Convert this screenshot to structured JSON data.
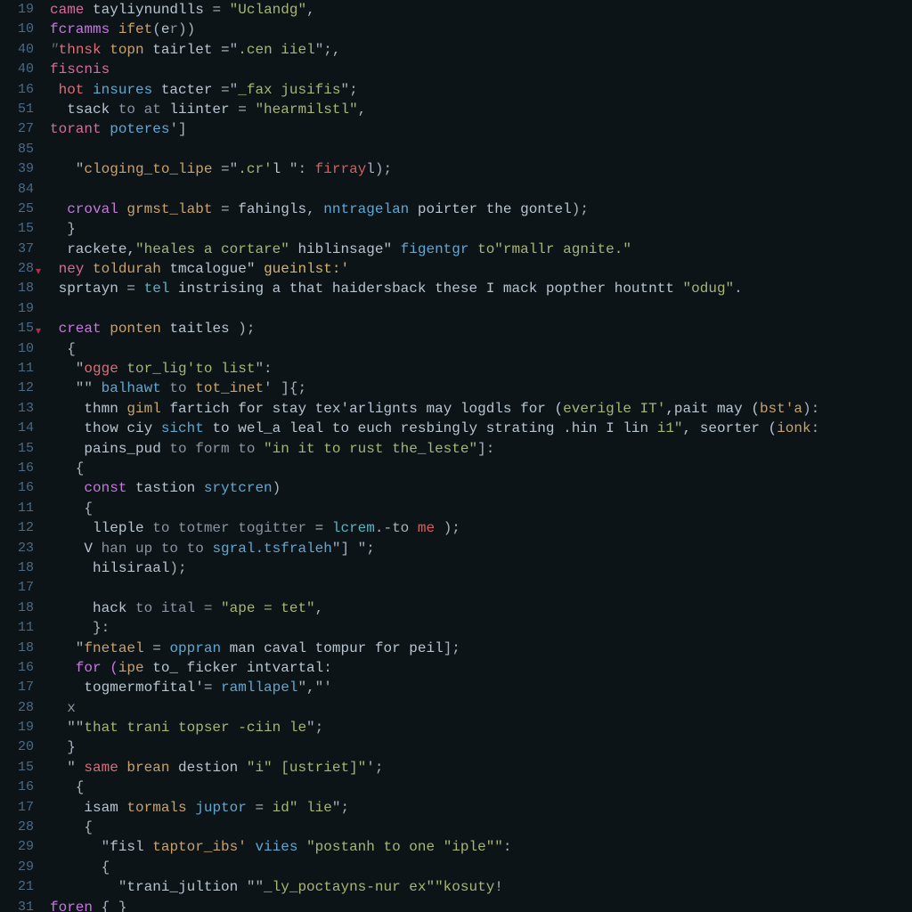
{
  "gutter": [
    "19",
    "10",
    "40",
    "40",
    "16",
    "51",
    "27",
    "85",
    "39",
    "84",
    "25",
    "15",
    "37",
    "28",
    "18",
    "19",
    "15",
    "10",
    "11",
    "12",
    "13",
    "14",
    "15",
    "16",
    "16",
    "11",
    "12",
    "23",
    "18",
    "17",
    "18",
    "11",
    "18",
    "16",
    "17",
    "28",
    "19",
    "20",
    "15",
    "16",
    "17",
    "28",
    "29",
    "29",
    "21",
    "31"
  ],
  "lines": [
    [
      {
        "t": "came ",
        "c": "kw2"
      },
      {
        "t": "tayliynundlls",
        "c": "pale"
      },
      {
        "t": " = ",
        "c": "op"
      },
      {
        "t": "\"Uclandg\"",
        "c": "str"
      },
      {
        "t": ",",
        "c": "op"
      }
    ],
    [
      {
        "t": "fcramms ",
        "c": "kw"
      },
      {
        "t": "ifet",
        "c": "tan"
      },
      {
        "t": "(",
        "c": "op"
      },
      {
        "t": "e",
        "c": "pale"
      },
      {
        "t": "r",
        "c": "dim"
      },
      {
        "t": "))",
        "c": "op"
      }
    ],
    [
      {
        "t": "\"",
        "c": "cm"
      },
      {
        "t": "thnsk ",
        "c": "err"
      },
      {
        "t": "topn ",
        "c": "tan"
      },
      {
        "t": "tairlet =",
        "c": "pale"
      },
      {
        "t": "\"",
        "c": "op"
      },
      {
        "t": ".cen iiel",
        "c": "str"
      },
      {
        "t": "\";,",
        "c": "op"
      }
    ],
    [
      {
        "t": "fiscnis",
        "c": "kw2"
      }
    ],
    [
      {
        "t": " hot ",
        "c": "err"
      },
      {
        "t": "insures ",
        "c": "fn"
      },
      {
        "t": "tacter ",
        "c": "pale"
      },
      {
        "t": "=\"",
        "c": "op"
      },
      {
        "t": "_fax jusifis",
        "c": "str"
      },
      {
        "t": "\";",
        "c": "op"
      }
    ],
    [
      {
        "t": "  tsack ",
        "c": "pale"
      },
      {
        "t": "to at ",
        "c": "dim"
      },
      {
        "t": "liinter",
        "c": "pale"
      },
      {
        "t": " = ",
        "c": "op"
      },
      {
        "t": "\"hearmilstl\"",
        "c": "str"
      },
      {
        "t": ",",
        "c": "op"
      }
    ],
    [
      {
        "t": "torant ",
        "c": "kw2"
      },
      {
        "t": "poteres",
        "c": "fn"
      },
      {
        "t": "']",
        "c": "op"
      }
    ],
    [
      {
        "t": "",
        "c": "op"
      }
    ],
    [
      {
        "t": "   \"",
        "c": "op"
      },
      {
        "t": "cloging_to_lipe",
        "c": "tan"
      },
      {
        "t": " =\"",
        "c": "op"
      },
      {
        "t": ".cr'",
        "c": "str"
      },
      {
        "t": "l",
        "c": "pale"
      },
      {
        "t": " \": ",
        "c": "op"
      },
      {
        "t": "firray",
        "c": "red"
      },
      {
        "t": "l);",
        "c": "op"
      }
    ],
    [
      {
        "t": "",
        "c": "op"
      }
    ],
    [
      {
        "t": "  croval ",
        "c": "kw"
      },
      {
        "t": "grmst_labt",
        "c": "tan"
      },
      {
        "t": " = ",
        "c": "op"
      },
      {
        "t": "fahingls",
        "c": "pale"
      },
      {
        "t": ", ",
        "c": "op"
      },
      {
        "t": "nntragelan ",
        "c": "fn"
      },
      {
        "t": "poirter the gontel",
        "c": "pale"
      },
      {
        "t": ");",
        "c": "op"
      }
    ],
    [
      {
        "t": "  }",
        "c": "op"
      }
    ],
    [
      {
        "t": "  rackete,",
        "c": "pale"
      },
      {
        "t": "\"heales a cortare\"",
        "c": "str"
      },
      {
        "t": " hiblinsage\" ",
        "c": "pale"
      },
      {
        "t": "figentgr ",
        "c": "fn"
      },
      {
        "t": "to\"rmallr agnite.\"",
        "c": "str"
      }
    ],
    [
      {
        "t": " ney ",
        "c": "kw2"
      },
      {
        "t": "toldurah ",
        "c": "tan"
      },
      {
        "t": "tmcalogue\" ",
        "c": "pale"
      },
      {
        "t": "gueinlst:'",
        "c": "gold"
      }
    ],
    [
      {
        "t": " sprtayn ",
        "c": "pale"
      },
      {
        "t": "= ",
        "c": "op"
      },
      {
        "t": "tel ",
        "c": "teal"
      },
      {
        "t": "instrising a that haidersback these I mack popther houtntt ",
        "c": "pale"
      },
      {
        "t": "\"odug\"",
        "c": "str"
      },
      {
        "t": ".",
        "c": "op"
      }
    ],
    [
      {
        "t": "",
        "c": "op"
      }
    ],
    [
      {
        "t": " creat ",
        "c": "kw"
      },
      {
        "t": "ponten ",
        "c": "tan"
      },
      {
        "t": "taitles ",
        "c": "pale"
      },
      {
        "t": ");",
        "c": "op"
      }
    ],
    [
      {
        "t": "  {",
        "c": "op"
      }
    ],
    [
      {
        "t": "   \"",
        "c": "op"
      },
      {
        "t": "ogge ",
        "c": "err"
      },
      {
        "t": "tor_lig'to list",
        "c": "str"
      },
      {
        "t": "\":",
        "c": "op"
      }
    ],
    [
      {
        "t": "   \"\" ",
        "c": "op"
      },
      {
        "t": "balhawt ",
        "c": "fn"
      },
      {
        "t": "to ",
        "c": "dim"
      },
      {
        "t": "tot_inet",
        "c": "tan"
      },
      {
        "t": "' ]{;",
        "c": "op"
      }
    ],
    [
      {
        "t": "    thmn ",
        "c": "pale"
      },
      {
        "t": "giml ",
        "c": "tan"
      },
      {
        "t": "fartich for stay tex'arlignts may logdls for (",
        "c": "pale"
      },
      {
        "t": "everigle IT'",
        "c": "str"
      },
      {
        "t": ",pait may (",
        "c": "pale"
      },
      {
        "t": "bst'a",
        "c": "tan"
      },
      {
        "t": "):",
        "c": "op"
      }
    ],
    [
      {
        "t": "    thow ciy ",
        "c": "pale"
      },
      {
        "t": "sicht ",
        "c": "fn"
      },
      {
        "t": "to wel_a leal to euch resbingly strating .hin I lin ",
        "c": "pale"
      },
      {
        "t": "i1\"",
        "c": "str"
      },
      {
        "t": ", seorter (",
        "c": "pale"
      },
      {
        "t": "ionk",
        "c": "tan"
      },
      {
        "t": ":",
        "c": "op"
      }
    ],
    [
      {
        "t": "    pains_pud ",
        "c": "pale"
      },
      {
        "t": "to form to ",
        "c": "dim"
      },
      {
        "t": "\"in it to rust the_leste\"",
        "c": "str"
      },
      {
        "t": "]:",
        "c": "op"
      }
    ],
    [
      {
        "t": "   {",
        "c": "op"
      }
    ],
    [
      {
        "t": "    const ",
        "c": "kw"
      },
      {
        "t": "tastion ",
        "c": "pale"
      },
      {
        "t": "srytcren",
        "c": "fn"
      },
      {
        "t": ")",
        "c": "op"
      }
    ],
    [
      {
        "t": "    {",
        "c": "op"
      }
    ],
    [
      {
        "t": "     lleple ",
        "c": "pale"
      },
      {
        "t": "to totmer togitter ",
        "c": "dim"
      },
      {
        "t": "= ",
        "c": "op"
      },
      {
        "t": "lcrem",
        "c": "teal"
      },
      {
        "t": ".-to ",
        "c": "op"
      },
      {
        "t": "me ",
        "c": "red"
      },
      {
        "t": ");",
        "c": "op"
      }
    ],
    [
      {
        "t": "    V ",
        "c": "pale"
      },
      {
        "t": "han up to to ",
        "c": "dim"
      },
      {
        "t": "sgral.tsfraleh",
        "c": "fn"
      },
      {
        "t": "\"] \";",
        "c": "op"
      }
    ],
    [
      {
        "t": "     hilsiraal",
        "c": "pale"
      },
      {
        "t": ");",
        "c": "op"
      }
    ],
    [
      {
        "t": "",
        "c": "op"
      }
    ],
    [
      {
        "t": "     hack ",
        "c": "pale"
      },
      {
        "t": "to ital = ",
        "c": "dim"
      },
      {
        "t": "\"ape = tet\"",
        "c": "str"
      },
      {
        "t": ",",
        "c": "op"
      }
    ],
    [
      {
        "t": "     }:",
        "c": "op"
      }
    ],
    [
      {
        "t": "   \"",
        "c": "op"
      },
      {
        "t": "fnetael",
        "c": "tan"
      },
      {
        "t": " = ",
        "c": "op"
      },
      {
        "t": "oppran ",
        "c": "fn"
      },
      {
        "t": "man caval tompur for peil",
        "c": "pale"
      },
      {
        "t": "];",
        "c": "op"
      }
    ],
    [
      {
        "t": "   for (",
        "c": "kw"
      },
      {
        "t": "ipe ",
        "c": "tan"
      },
      {
        "t": "to_ ficker intvartal",
        "c": "pale"
      },
      {
        "t": ":",
        "c": "op"
      }
    ],
    [
      {
        "t": "    togmermofital'",
        "c": "pale"
      },
      {
        "t": "= ",
        "c": "op"
      },
      {
        "t": "ramllapel",
        "c": "fn"
      },
      {
        "t": "\",\"'",
        "c": "op"
      }
    ],
    [
      {
        "t": "  x",
        "c": "dim"
      }
    ],
    [
      {
        "t": "  \"\"",
        "c": "op"
      },
      {
        "t": "that trani topser -ciin le",
        "c": "str"
      },
      {
        "t": "\";",
        "c": "op"
      }
    ],
    [
      {
        "t": "  }",
        "c": "op"
      }
    ],
    [
      {
        "t": "  \" ",
        "c": "op"
      },
      {
        "t": "same ",
        "c": "err"
      },
      {
        "t": "brean ",
        "c": "tan"
      },
      {
        "t": "destion ",
        "c": "pale"
      },
      {
        "t": "\"i\" [ustriet]\"",
        "c": "str"
      },
      {
        "t": "';",
        "c": "op"
      }
    ],
    [
      {
        "t": "   {",
        "c": "op"
      }
    ],
    [
      {
        "t": "    isam ",
        "c": "pale"
      },
      {
        "t": "tormals ",
        "c": "tan"
      },
      {
        "t": "juptor ",
        "c": "fn"
      },
      {
        "t": "= ",
        "c": "op"
      },
      {
        "t": "id\" lie",
        "c": "str"
      },
      {
        "t": "\";",
        "c": "op"
      }
    ],
    [
      {
        "t": "    {",
        "c": "op"
      }
    ],
    [
      {
        "t": "      \"",
        "c": "op"
      },
      {
        "t": "fisl ",
        "c": "pale"
      },
      {
        "t": "taptor_ibs' ",
        "c": "tan"
      },
      {
        "t": "viies ",
        "c": "fn"
      },
      {
        "t": "\"postanh to one \"iple\"\"",
        "c": "str"
      },
      {
        "t": ":",
        "c": "op"
      }
    ],
    [
      {
        "t": "      {",
        "c": "op"
      }
    ],
    [
      {
        "t": "        \"",
        "c": "op"
      },
      {
        "t": "trani_jultion ",
        "c": "pale"
      },
      {
        "t": "\"\"",
        "c": "op"
      },
      {
        "t": "_ly_poctayns-nur ex\"\"kosuty",
        "c": "str"
      },
      {
        "t": "!",
        "c": "op"
      }
    ],
    [
      {
        "t": "foren ",
        "c": "kw"
      },
      {
        "t": "{ }",
        "c": "op"
      }
    ]
  ],
  "fold_rows": [
    13,
    16
  ]
}
